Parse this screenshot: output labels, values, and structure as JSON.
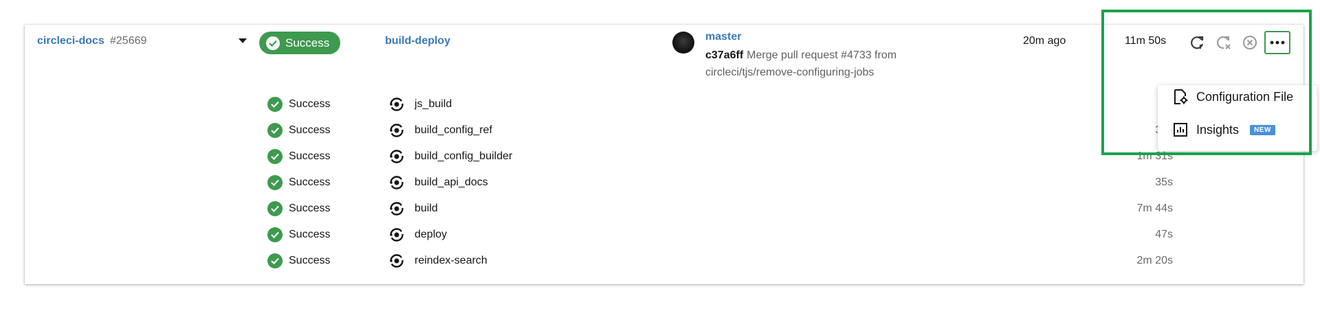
{
  "pipeline": {
    "project": "circleci-docs",
    "number": "#25669",
    "status": "Success",
    "workflow": "build-deploy",
    "branch": "master",
    "commit_sha": "c37a6ff",
    "commit_message_line1": "Merge pull request #4733 from",
    "commit_message_line2": "circleci/tjs/remove-configuring-jobs",
    "time_ago": "20m ago",
    "duration": "11m 50s"
  },
  "actions": {
    "rerun_icon": "rerun-icon",
    "rerun_failed_icon": "rerun-failed-icon",
    "cancel_icon": "cancel-icon",
    "more_icon": "more-icon"
  },
  "jobs": [
    {
      "status": "Success",
      "name": "js_build",
      "duration": ""
    },
    {
      "status": "Success",
      "name": "build_config_ref",
      "duration": "38s"
    },
    {
      "status": "Success",
      "name": "build_config_builder",
      "duration": "1m 31s"
    },
    {
      "status": "Success",
      "name": "build_api_docs",
      "duration": "35s"
    },
    {
      "status": "Success",
      "name": "build",
      "duration": "7m 44s"
    },
    {
      "status": "Success",
      "name": "deploy",
      "duration": "47s"
    },
    {
      "status": "Success",
      "name": "reindex-search",
      "duration": "2m 20s"
    }
  ],
  "menu": {
    "items": [
      {
        "label": "Configuration File",
        "icon": "config-file-icon"
      },
      {
        "label": "Insights",
        "icon": "insights-icon",
        "badge": "NEW"
      }
    ]
  },
  "colors": {
    "success": "#3d9a4e",
    "link": "#3b78b8",
    "highlight": "#1aa24a",
    "badge": "#4a90d9"
  }
}
